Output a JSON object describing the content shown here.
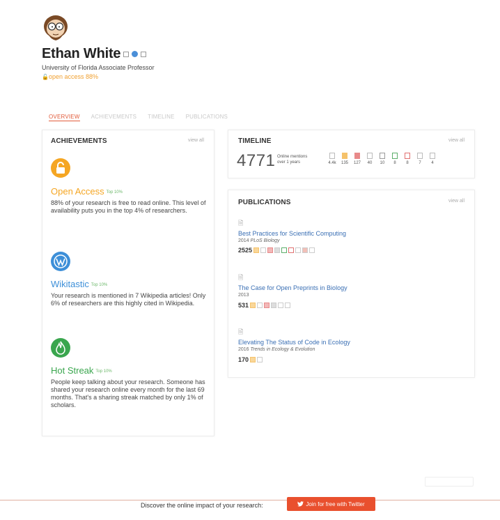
{
  "profile": {
    "name": "Ethan White",
    "affiliation": "University of Florida Associate Professor",
    "open_access": "open access 88%"
  },
  "tabs": [
    "OVERVIEW",
    "ACHIEVEMENTS",
    "TIMELINE",
    "PUBLICATIONS"
  ],
  "achievements": {
    "title": "ACHIEVEMENTS",
    "view_all": "view all",
    "items": [
      {
        "name": "Open Access",
        "badge": "Top 10%",
        "icon": "lock-icon",
        "color": "#f5a623",
        "desc": "88% of your research is free to read online. This level of availability puts you in the top 4% of researchers."
      },
      {
        "name": "Wikitastic",
        "badge": "Top 10%",
        "icon": "wikipedia-icon",
        "color": "#3d8fd8",
        "desc": "Your research is mentioned in 7 Wikipedia articles! Only 6% of researchers are this highly cited in Wikipedia."
      },
      {
        "name": "Hot Streak",
        "badge": "Top 10%",
        "icon": "flame-icon",
        "color": "#3aa64e",
        "desc": "People keep talking about your research. Someone has shared your research online every month for the last 69 months. That's a sharing streak matched by only 1% of scholars."
      }
    ]
  },
  "timeline": {
    "title": "TIMELINE",
    "view_all": "view all",
    "count": "4771",
    "label_line1": "Online mentions",
    "label_line2": "over 1 years",
    "stats": [
      {
        "value": "4.4k",
        "color": "#bbbbbb"
      },
      {
        "value": "135",
        "color": "#f5c26b"
      },
      {
        "value": "127",
        "color": "#e88a8a"
      },
      {
        "value": "40",
        "color": "#bbbbbb"
      },
      {
        "value": "10",
        "color": "#9a9a9a"
      },
      {
        "value": "8",
        "color": "#5cae6a"
      },
      {
        "value": "8",
        "color": "#e07070"
      },
      {
        "value": "7",
        "color": "#bbbbbb"
      },
      {
        "value": "4",
        "color": "#bbbbbb"
      }
    ]
  },
  "publications": {
    "title": "PUBLICATIONS",
    "view_all": "view all",
    "items": [
      {
        "title": "Best Practices for Scientific Computing",
        "year": "2014",
        "venue": "PLoS Biology",
        "score": "2525"
      },
      {
        "title": "The Case for Open Preprints in Biology",
        "year": "2013",
        "venue": "",
        "score": "531"
      },
      {
        "title": "Elevating The Status of Code in Ecology",
        "year": "2016",
        "venue": "Trends in Ecology & Evolution",
        "score": "170"
      }
    ]
  },
  "footer": {
    "cta_text": "Discover the online impact of your research:",
    "cta_button": "Join for free with Twitter",
    "accent_color": "#e9502e"
  }
}
